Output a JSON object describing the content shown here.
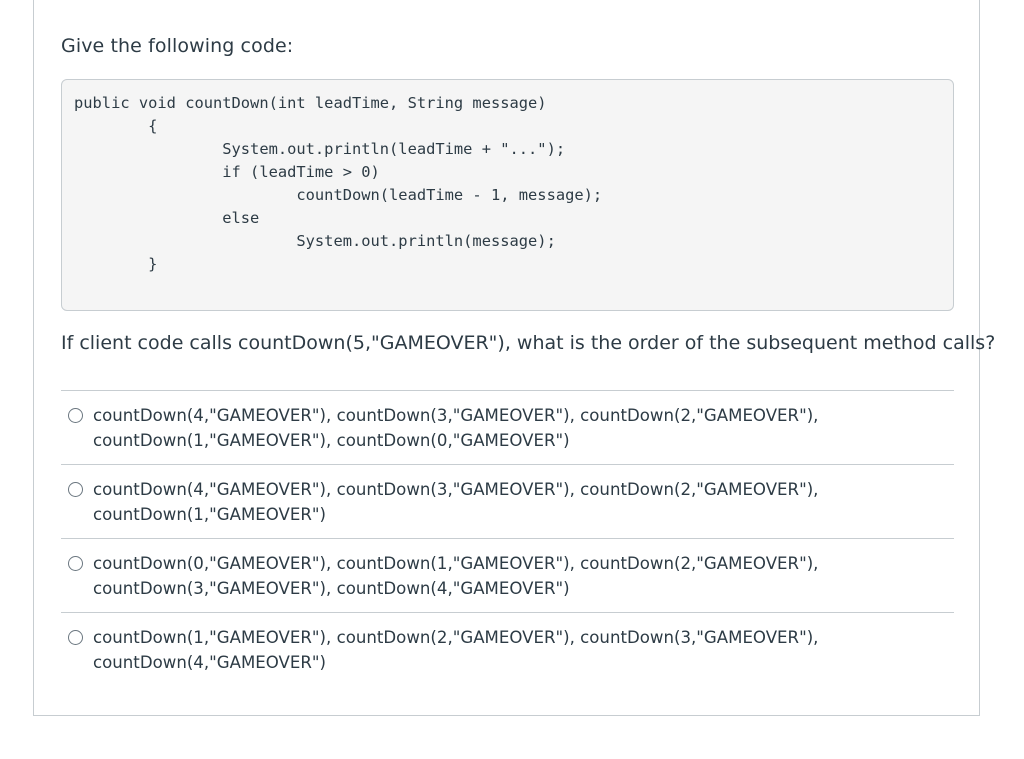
{
  "prompt": "Give the following code:",
  "code": "public void countDown(int leadTime, String message)\n        {\n                System.out.println(leadTime + \"...\");\n                if (leadTime > 0)\n                        countDown(leadTime - 1, message);\n                else\n                        System.out.println(message);\n        }",
  "question": "If client code calls countDown(5,\"GAMEOVER\"), what is the order of the subsequent method calls?",
  "answers": [
    {
      "line1": "countDown(4,\"GAMEOVER\"), countDown(3,\"GAMEOVER\"), countDown(2,\"GAMEOVER\"),",
      "line2": "countDown(1,\"GAMEOVER\"), countDown(0,\"GAMEOVER\")"
    },
    {
      "line1": "countDown(4,\"GAMEOVER\"), countDown(3,\"GAMEOVER\"), countDown(2,\"GAMEOVER\"),",
      "line2": "countDown(1,\"GAMEOVER\")"
    },
    {
      "line1": "countDown(0,\"GAMEOVER\"), countDown(1,\"GAMEOVER\"), countDown(2,\"GAMEOVER\"),",
      "line2": "countDown(3,\"GAMEOVER\"), countDown(4,\"GAMEOVER\")"
    },
    {
      "line1": "countDown(1,\"GAMEOVER\"), countDown(2,\"GAMEOVER\"), countDown(3,\"GAMEOVER\"),",
      "line2": "countDown(4,\"GAMEOVER\")"
    }
  ],
  "colors": {
    "text": "#2d3b45",
    "border": "#c7cdd1",
    "code_background": "#f5f5f5"
  },
  "icons": {
    "answer_selector": "radio-button-icon"
  }
}
